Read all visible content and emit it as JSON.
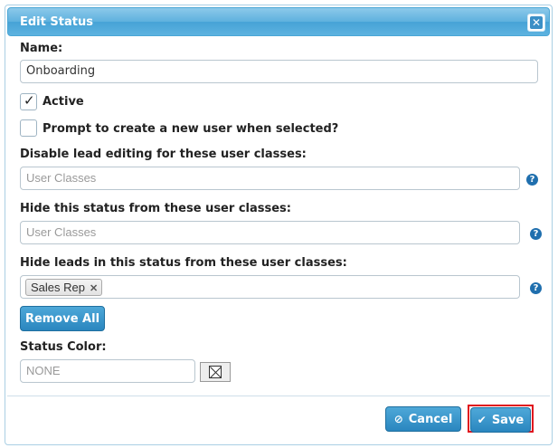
{
  "dialog": {
    "title": "Edit Status",
    "close_icon": "close-icon"
  },
  "fields": {
    "name_label": "Name:",
    "name_value": "Onboarding",
    "active_label": "Active",
    "active_checked": true,
    "prompt_label": "Prompt to create a new user when selected?",
    "prompt_checked": false,
    "disable_label": "Disable lead editing for these user classes:",
    "disable_placeholder": "User Classes",
    "hide_status_label": "Hide this status from these user classes:",
    "hide_status_placeholder": "User Classes",
    "hide_leads_label": "Hide leads in this status from these user classes:",
    "hide_leads_tags": [
      "Sales Rep"
    ],
    "remove_all_label": "Remove All",
    "color_label": "Status Color:",
    "color_placeholder": "NONE"
  },
  "help_icon": "?",
  "footer": {
    "cancel_label": "Cancel",
    "cancel_icon": "ban-icon",
    "save_label": "Save",
    "save_icon": "check-icon"
  },
  "colors": {
    "accent": "#3d97cf",
    "highlight": "#e0141e"
  }
}
